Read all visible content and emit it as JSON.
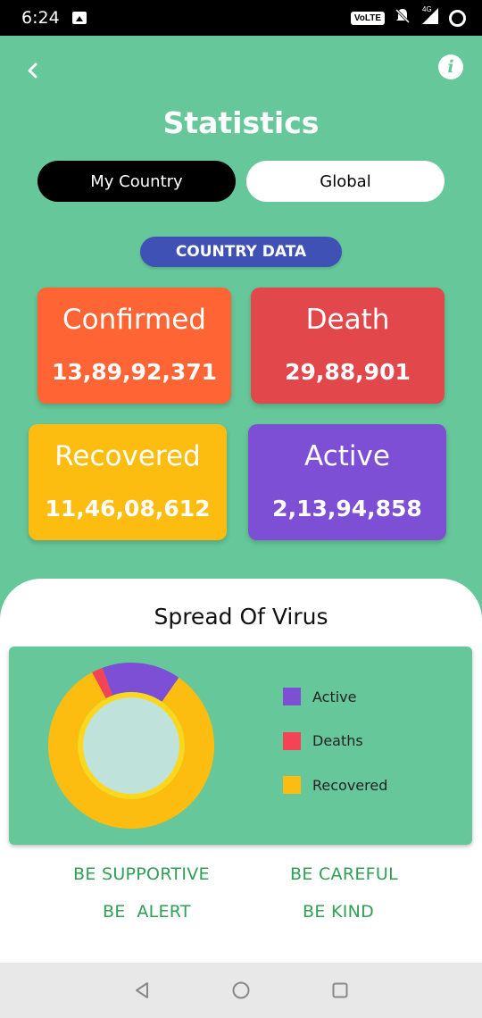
{
  "status_bar": {
    "time": "6:24",
    "volte": "VoLTE",
    "network": "4G"
  },
  "header": {
    "title": "Statistics",
    "back_icon": "chevron-left-icon",
    "info_icon": "info-icon",
    "info_glyph": "i"
  },
  "tabs": [
    {
      "label": "My Country",
      "active": true
    },
    {
      "label": "Global",
      "active": false
    }
  ],
  "section_label": "COUNTRY DATA",
  "cards": {
    "confirmed": {
      "label": "Confirmed",
      "value": "13,89,92,371",
      "color": "#ff6435"
    },
    "death": {
      "label": "Death",
      "value": "29,88,901",
      "color": "#e2474c"
    },
    "recovered": {
      "label": "Recovered",
      "value": "11,46,08,612",
      "color": "#fdbd10"
    },
    "active": {
      "label": "Active",
      "value": "2,13,94,858",
      "color": "#7c4fd4"
    }
  },
  "spread": {
    "title": "Spread Of Virus",
    "legend": [
      {
        "label": "Active",
        "color": "#7c4fd4"
      },
      {
        "label": "Deaths",
        "color": "#f44355"
      },
      {
        "label": "Recovered",
        "color": "#fdbd10"
      }
    ]
  },
  "chart_data": {
    "type": "pie",
    "style": "donut",
    "categories": [
      "Active",
      "Deaths",
      "Recovered"
    ],
    "values": [
      21394858,
      2988901,
      114608612
    ],
    "colors": [
      "#7c4fd4",
      "#f44355",
      "#fdbd10"
    ],
    "legend_position": "right"
  },
  "slogans": [
    "BE SUPPORTIVE",
    "BE CAREFUL",
    "BE  ALERT",
    "BE KIND"
  ],
  "nav": {
    "back": "nav-back-icon",
    "home": "nav-home-icon",
    "recents": "nav-recents-icon"
  },
  "colors": {
    "primary_green": "#66c89a",
    "pill_blue": "#3f51b5",
    "slogan_green": "#2f9f56"
  }
}
